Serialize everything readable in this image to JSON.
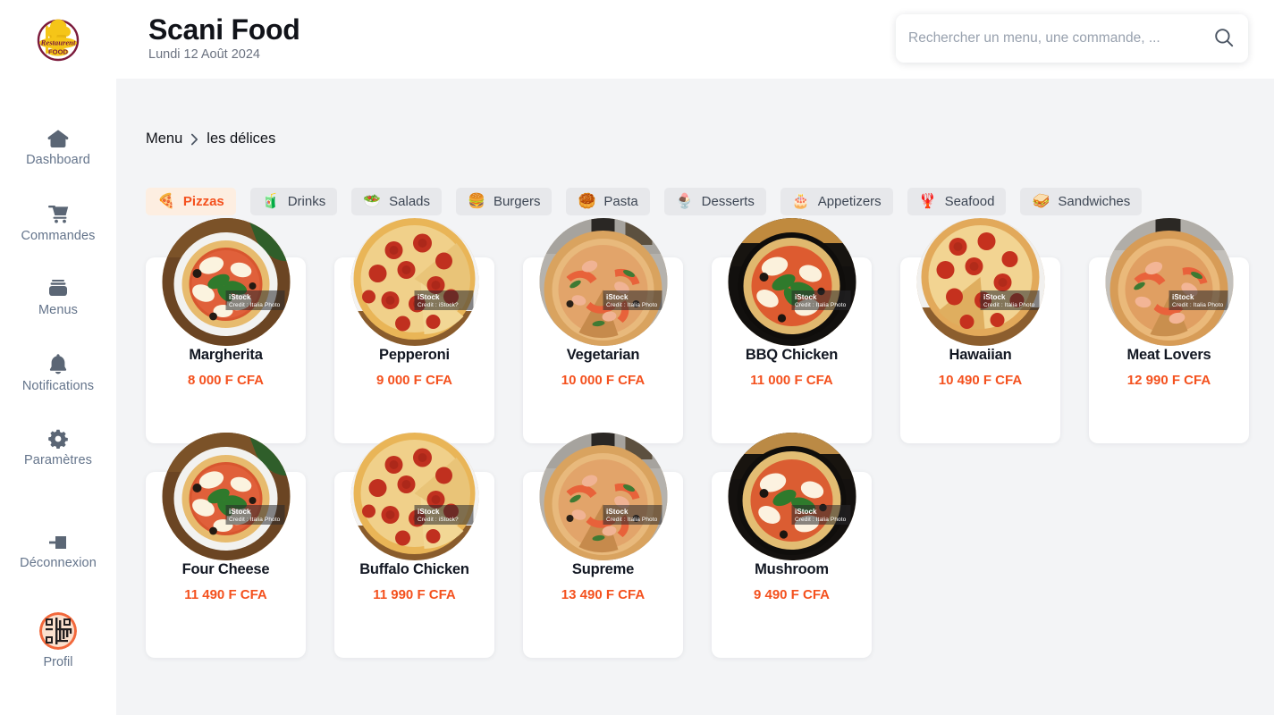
{
  "brand": {
    "logo_icon": "restaurant-food-logo",
    "title": "Scani Food",
    "date": "Lundi 12 Août 2024"
  },
  "search": {
    "placeholder": "Rechercher un menu, une commande, ...",
    "value": "",
    "icon": "search-icon"
  },
  "sidebar": {
    "items": [
      {
        "label": "Dashboard",
        "icon": "home-icon"
      },
      {
        "label": "Commandes",
        "icon": "shopping-cart-icon"
      },
      {
        "label": "Menus",
        "icon": "menus-stack-icon"
      },
      {
        "label": "Notifications",
        "icon": "bell-icon"
      },
      {
        "label": "Paramètres",
        "icon": "gear-icon"
      },
      {
        "label": "Déconnexion",
        "icon": "logout-arrow-icon"
      }
    ],
    "profile": {
      "label": "Profil",
      "icon": "qr-avatar-icon"
    }
  },
  "breadcrumb": {
    "root": "Menu",
    "separator": "›",
    "current": "les délices"
  },
  "categories": [
    {
      "label": "Pizzas",
      "emoji": "🍕",
      "icon": "pizza-icon",
      "active": true
    },
    {
      "label": "Drinks",
      "emoji": "🧃",
      "icon": "drinks-icon",
      "active": false
    },
    {
      "label": "Salads",
      "emoji": "🥗",
      "icon": "salad-icon",
      "active": false
    },
    {
      "label": "Burgers",
      "emoji": "🍔",
      "icon": "burger-icon",
      "active": false
    },
    {
      "label": "Pasta",
      "emoji": "🥮",
      "icon": "pasta-icon",
      "active": false
    },
    {
      "label": "Desserts",
      "emoji": "🍨",
      "icon": "dessert-icon",
      "active": false
    },
    {
      "label": "Appetizers",
      "emoji": "🎂",
      "icon": "appetizer-icon",
      "active": false
    },
    {
      "label": "Seafood",
      "emoji": "🦞",
      "icon": "seafood-icon",
      "active": false
    },
    {
      "label": "Sandwiches",
      "emoji": "🥪",
      "icon": "sandwich-icon",
      "active": false
    }
  ],
  "currency": "F CFA",
  "products": [
    {
      "name": "Margherita",
      "price": "8 000 F CFA",
      "photo": "margherita-pizza-photo",
      "watermark_top": "iStock",
      "watermark_sub": "Credit : Italia Photo"
    },
    {
      "name": "Pepperoni",
      "price": "9 000 F CFA",
      "photo": "pepperoni-pizza-photo",
      "watermark_top": "iStock",
      "watermark_sub": "Credit : iStock?"
    },
    {
      "name": "Vegetarian",
      "price": "10 000 F CFA",
      "photo": "vegetarian-pizza-photo",
      "watermark_top": "iStock",
      "watermark_sub": "Credit : Italia Photo"
    },
    {
      "name": "BBQ Chicken",
      "price": "11 000 F CFA",
      "photo": "bbq-chicken-pizza-photo",
      "watermark_top": "iStock",
      "watermark_sub": "Credit : Italia Photo"
    },
    {
      "name": "Hawaiian",
      "price": "10 490 F CFA",
      "photo": "hawaiian-pizza-photo",
      "watermark_top": "iStock",
      "watermark_sub": "Credit : Italia Photo"
    },
    {
      "name": "Meat Lovers",
      "price": "12 990 F CFA",
      "photo": "meat-lovers-pizza-photo",
      "watermark_top": "iStock",
      "watermark_sub": "Credit : Italia Photo"
    },
    {
      "name": "Four Cheese",
      "price": "11 490 F CFA",
      "photo": "four-cheese-pizza-photo",
      "watermark_top": "iStock",
      "watermark_sub": "Credit : Italia Photo"
    },
    {
      "name": "Buffalo Chicken",
      "price": "11 990 F CFA",
      "photo": "buffalo-chicken-pizza-photo",
      "watermark_top": "iStock",
      "watermark_sub": "Credit : iStock?"
    },
    {
      "name": "Supreme",
      "price": "13 490 F CFA",
      "photo": "supreme-pizza-photo",
      "watermark_top": "iStock",
      "watermark_sub": "Credit : Italia Photo"
    },
    {
      "name": "Mushroom",
      "price": "9 490 F CFA",
      "photo": "mushroom-pizza-photo",
      "watermark_top": "iStock",
      "watermark_sub": "Credit : Italia Photo"
    }
  ],
  "colors": {
    "accent": "#f4511e",
    "accent_soft": "#fdeee1",
    "page_bg": "#f3f4f6",
    "surface": "#ffffff",
    "tab_bg": "#e7e8eb",
    "text": "#111319",
    "muted": "#6b7280"
  }
}
